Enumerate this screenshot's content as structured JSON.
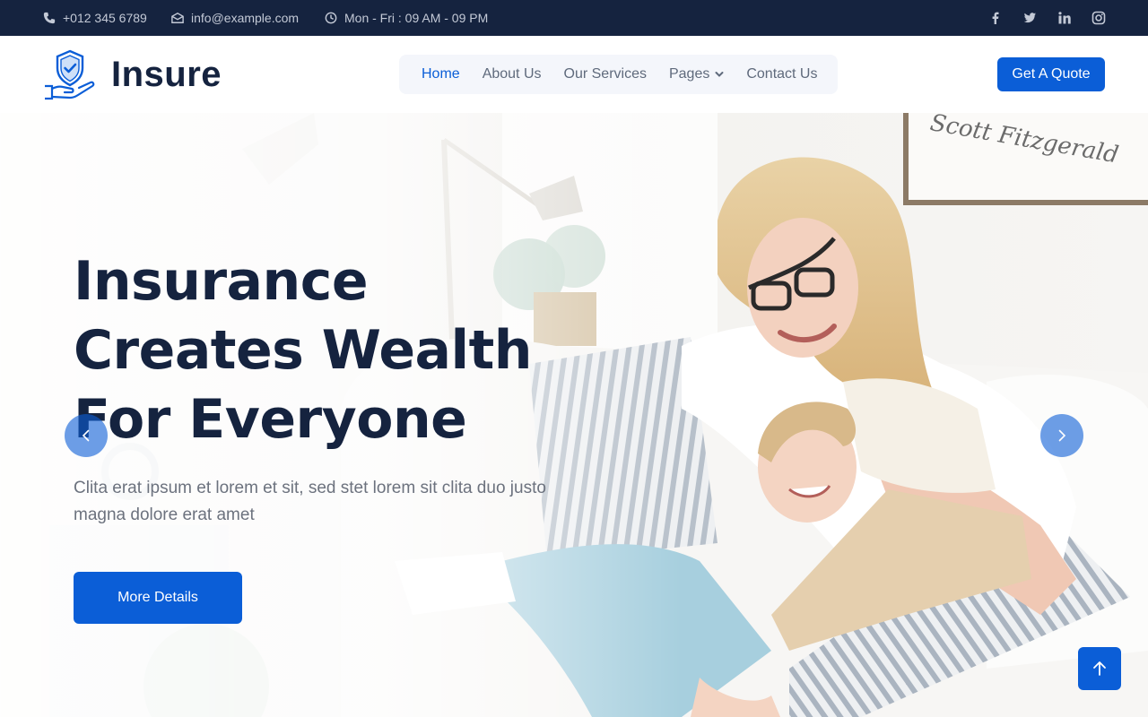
{
  "topbar": {
    "phone": "+012 345 6789",
    "email": "info@example.com",
    "hours": "Mon - Fri : 09 AM - 09 PM",
    "social": [
      "facebook-icon",
      "twitter-icon",
      "linkedin-icon",
      "instagram-icon"
    ]
  },
  "brand": {
    "name": "Insure",
    "logo_icon": "shield-hand-icon"
  },
  "nav": {
    "items": [
      {
        "label": "Home",
        "active": true
      },
      {
        "label": "About Us"
      },
      {
        "label": "Our Services"
      },
      {
        "label": "Pages",
        "has_dropdown": true
      },
      {
        "label": "Contact Us"
      }
    ],
    "cta_label": "Get A Quote"
  },
  "hero": {
    "title_line1": "Insurance",
    "title_line2": "Creates Wealth",
    "title_line3": "For Everyone",
    "lead": "Clita erat ipsum et lorem et sit, sed stet lorem sit clita duo justo magna dolore erat amet",
    "button_label": "More Details",
    "frame_text": "Scott Fitzgerald"
  },
  "colors": {
    "primary": "#0b5ed7",
    "dark": "#15233f",
    "muted": "#6c727e"
  }
}
